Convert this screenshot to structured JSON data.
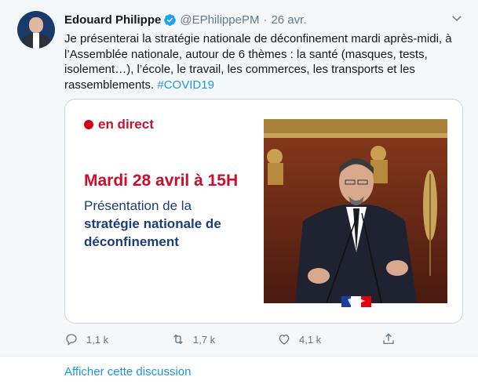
{
  "tweet": {
    "author_name": "Edouard Philippe",
    "handle": "@EPhilippePM",
    "separator": "·",
    "date": "26 avr.",
    "text": "Je présenterai la stratégie nationale de déconfinement mardi après-midi, à l’Assemblée nationale, autour de 6 thèmes : la santé (masques, tests, isolement…), l’école, le travail, les commerces, les transports et les rassemblements. ",
    "hashtag": "#COVID19",
    "verified": true
  },
  "card": {
    "live_label": "en direct",
    "headline": "Mardi 28 avril à 15H",
    "subtitle_line1": "Présentation de la",
    "subtitle_line2": "stratégie nationale de",
    "subtitle_line3": "déconfinement"
  },
  "actions": {
    "reply_count": "1,1 k",
    "retweet_count": "1,7 k",
    "like_count": "4,1 k"
  },
  "footer": {
    "show_thread": "Afficher cette discussion"
  },
  "colors": {
    "link": "#1b95e0",
    "verified": "#1da1f2",
    "live_red": "#c8102e",
    "card_blue": "#1d3d7a",
    "muted": "#657786"
  },
  "icons": [
    "verified-badge-icon",
    "chevron-down-icon",
    "reply-icon",
    "retweet-icon",
    "like-icon",
    "share-icon"
  ]
}
